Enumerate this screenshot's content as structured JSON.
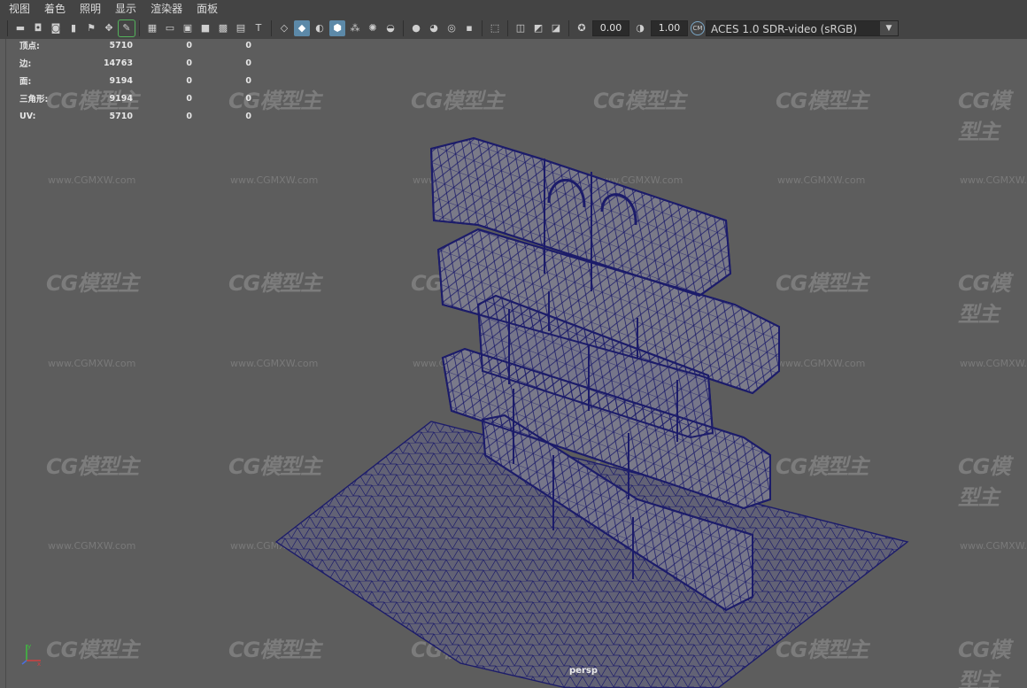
{
  "menu": [
    "视图",
    "着色",
    "照明",
    "显示",
    "渲染器",
    "面板"
  ],
  "toolbar": {
    "exposure_value": "0.00",
    "gamma_value": "1.00",
    "color_space": "ACES 1.0 SDR-video (sRGB)"
  },
  "hud": {
    "rows": [
      {
        "label": "顶点:",
        "v1": "5710",
        "v2": "0",
        "v3": "0"
      },
      {
        "label": "边:",
        "v1": "14763",
        "v2": "0",
        "v3": "0"
      },
      {
        "label": "面:",
        "v1": "9194",
        "v2": "0",
        "v3": "0"
      },
      {
        "label": "三角形:",
        "v1": "9194",
        "v2": "0",
        "v3": "0"
      },
      {
        "label": "UV:",
        "v1": "5710",
        "v2": "0",
        "v3": "0"
      }
    ]
  },
  "viewport": {
    "camera_label": "persp",
    "wireframe_color": "#1a1a6e"
  },
  "watermark": {
    "logo_text": "CG模型主",
    "url_text": "www.CGMXW.com"
  },
  "colors": {
    "background": "#5d5d5d",
    "toolbar": "#444444",
    "active_button": "#5c89a8"
  }
}
